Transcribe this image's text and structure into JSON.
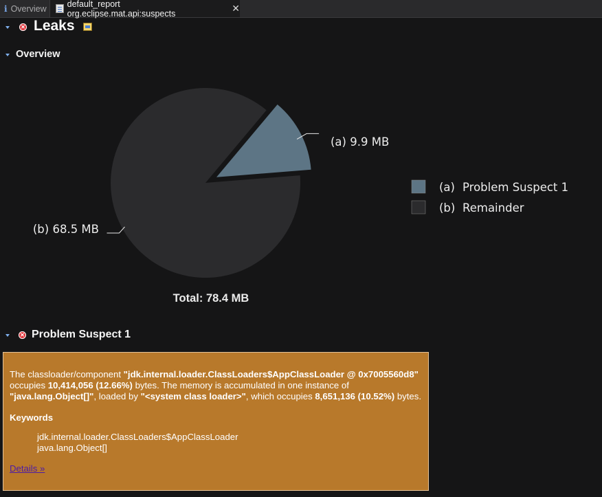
{
  "tabs": [
    {
      "label": "Overview",
      "icon": "info-icon"
    },
    {
      "label": "default_report org.eclipse.mat.api:suspects",
      "icon": "report-icon",
      "close": "✕"
    }
  ],
  "sections": {
    "leaks_title": "Leaks",
    "overview_title": "Overview",
    "suspect_title": "Problem Suspect 1"
  },
  "chart_data": {
    "type": "pie",
    "title": "",
    "total_label": "Total: 78.4 MB",
    "slices": [
      {
        "key": "(a)",
        "name": "Problem Suspect 1",
        "value": 9.9,
        "unit": "MB",
        "label": "(a)  9.9 MB",
        "color": "#5d7585",
        "exploded": true
      },
      {
        "key": "(b)",
        "name": "Remainder",
        "value": 68.5,
        "unit": "MB",
        "label": "(b)  68.5 MB",
        "color": "#2b2b2d",
        "exploded": false
      }
    ],
    "legend": [
      {
        "key": "(a)",
        "label": "Problem Suspect 1"
      },
      {
        "key": "(b)",
        "label": "Remainder"
      }
    ],
    "legend_position": "right"
  },
  "suspect": {
    "p1_a": "The classloader/component ",
    "p1_b": "\"jdk.internal.loader.ClassLoaders$AppClassLoader @ 0x7005560d8\"",
    "p1_c": " occupies ",
    "p1_d": "10,414,056 (12.66%)",
    "p1_e": " bytes. The memory is accumulated in one instance of ",
    "p1_f": "\"java.lang.Object[]\"",
    "p1_g": ", loaded by ",
    "p1_h": "\"<system class loader>\"",
    "p1_i": ", which occupies ",
    "p1_j": "8,651,136 (10.52%)",
    "p1_k": " bytes.",
    "keywords_title": "Keywords",
    "keywords": [
      "jdk.internal.loader.ClassLoaders$AppClassLoader",
      "java.lang.Object[]"
    ],
    "details_link": "Details »"
  },
  "colors": {
    "background": "#151516",
    "suspect_box": "#b8792b",
    "link": "#4b1aa8",
    "twisty": "#7fb0ee"
  }
}
